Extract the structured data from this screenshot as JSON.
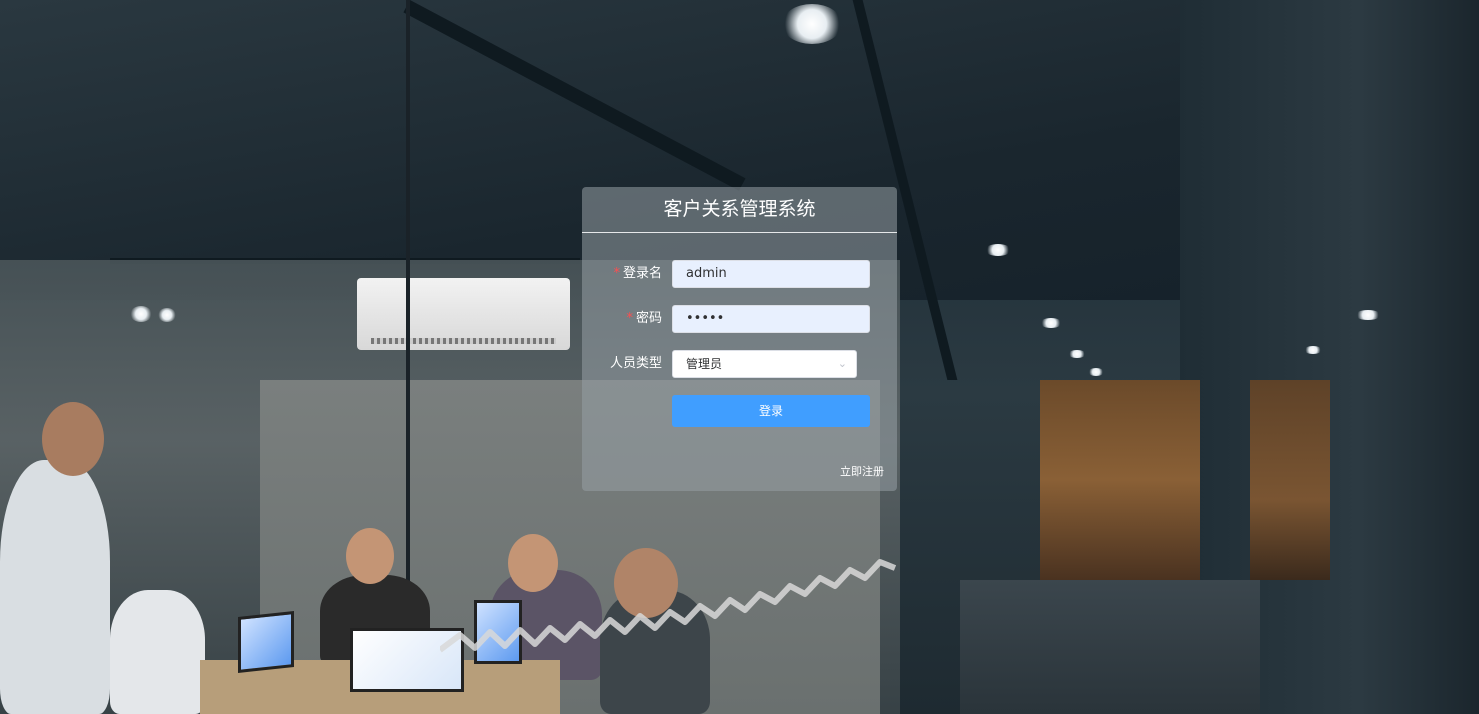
{
  "login": {
    "title": "客户关系管理系统",
    "username_label": "登录名",
    "username_value": "admin",
    "password_label": "密码",
    "password_value": "•••••",
    "role_label": "人员类型",
    "role_value": "管理员",
    "required_mark": "*",
    "submit_label": "登录",
    "register_label": "立即注册"
  },
  "colors": {
    "primary_button": "#409eff",
    "required_mark": "#ff4d4f",
    "input_autofill_bg": "#e8f0fe"
  },
  "icons": {
    "select_arrow": "chevron-down-icon"
  }
}
